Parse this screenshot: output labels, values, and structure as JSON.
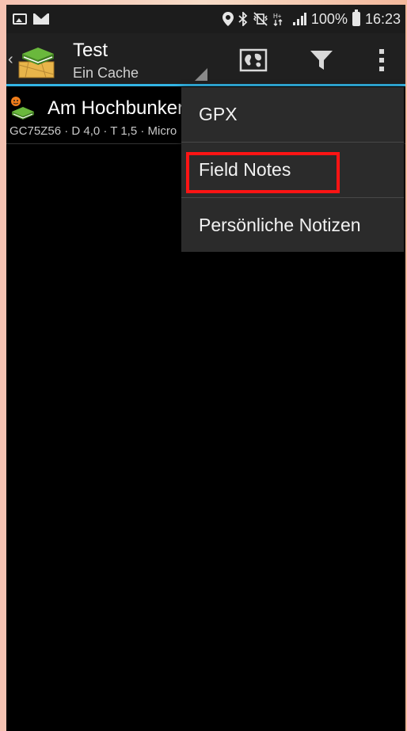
{
  "statusbar": {
    "battery_text": "100%",
    "time": "16:23"
  },
  "actionbar": {
    "title": "Test",
    "subtitle": "Ein Cache",
    "accent_color": "#33b5e5"
  },
  "list": {
    "items": [
      {
        "name": "Am Hochbunker",
        "details": "GC75Z56 · D 4,0 · T 1,5 · Micro"
      }
    ]
  },
  "menu": {
    "items": [
      {
        "label": "GPX"
      },
      {
        "label": "Field Notes",
        "highlighted": true
      },
      {
        "label": "Persönliche Notizen"
      }
    ],
    "highlight_color": "#ff1414"
  }
}
